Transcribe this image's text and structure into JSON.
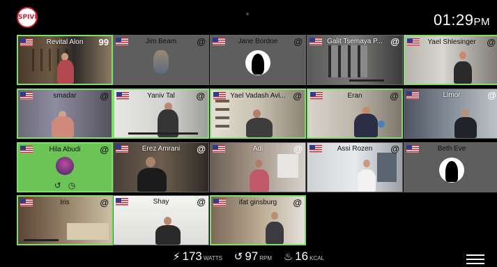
{
  "header": {
    "logo_text": "SPIVI",
    "time": "01:29",
    "ampm": "PM"
  },
  "participants": [
    {
      "name": "Revital Alon",
      "badge": "99"
    },
    {
      "name": "Jim Beam",
      "badge": "@"
    },
    {
      "name": "Jane Bordoe",
      "badge": "@"
    },
    {
      "name": "Galit Tsemaya P...",
      "badge": "@"
    },
    {
      "name": "Yael Shlesinger",
      "badge": "@"
    },
    {
      "name": "smadar",
      "badge": "@"
    },
    {
      "name": "Yaniv Tal",
      "badge": "@"
    },
    {
      "name": "Yael Vadash Avi...",
      "badge": "@"
    },
    {
      "name": "Eran",
      "badge": "@"
    },
    {
      "name": "Limor",
      "badge": "@"
    },
    {
      "name": "Hila Abudi",
      "badge": "@"
    },
    {
      "name": "Erez Amrani",
      "badge": "@"
    },
    {
      "name": "Adi",
      "badge": "@"
    },
    {
      "name": "Assi Rozen",
      "badge": "@"
    },
    {
      "name": "Beth Eve",
      "badge": "@"
    },
    {
      "name": "Iris",
      "badge": "@"
    },
    {
      "name": "Shay",
      "badge": "@"
    },
    {
      "name": "ifat ginsburg",
      "badge": "@"
    }
  ],
  "stats": {
    "power": {
      "value": "173",
      "unit": "WATTS",
      "icon": "lightning-icon"
    },
    "cadence": {
      "value": "97",
      "unit": "RPM",
      "icon": "cadence-icon"
    },
    "calories": {
      "value": "16",
      "unit": "KCAL",
      "icon": "flame-icon"
    }
  },
  "colors": {
    "highlight": "#7fe06a",
    "flag_red": "#c8202f",
    "flag_blue": "#2b3e8c"
  }
}
